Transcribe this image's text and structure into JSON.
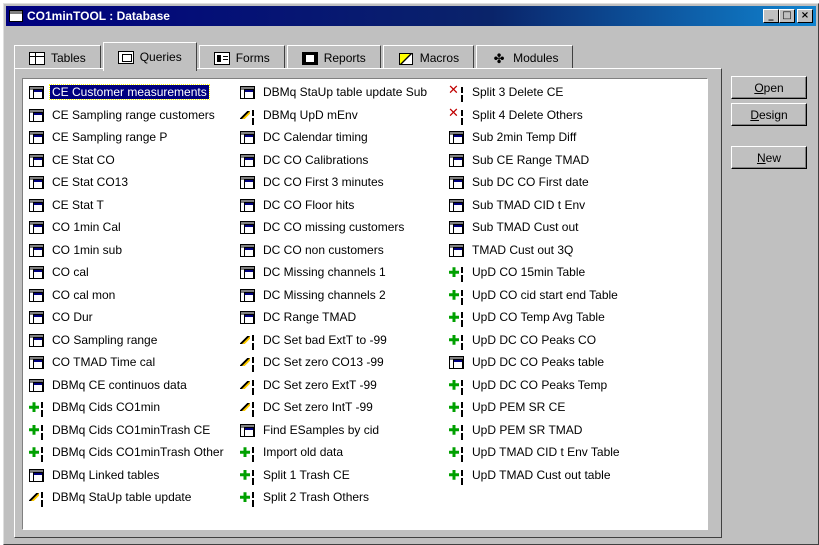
{
  "window": {
    "title": "CO1minTOOL : Database",
    "icon": "database-window-icon",
    "controls": [
      "minimize",
      "maximize",
      "close"
    ]
  },
  "tabs": [
    {
      "label": "Tables",
      "icon": "table-icon",
      "active": false
    },
    {
      "label": "Queries",
      "icon": "query-icon",
      "active": true
    },
    {
      "label": "Forms",
      "icon": "form-icon",
      "active": false
    },
    {
      "label": "Reports",
      "icon": "report-icon",
      "active": false
    },
    {
      "label": "Macros",
      "icon": "macro-icon",
      "active": false
    },
    {
      "label": "Modules",
      "icon": "module-icon",
      "active": false
    }
  ],
  "buttons": {
    "open": {
      "access": "O",
      "rest": "pen"
    },
    "design": {
      "access": "D",
      "rest": "esign"
    },
    "new": {
      "access": "N",
      "rest": "ew"
    }
  },
  "columns": [
    [
      {
        "name": "CE Customer measurements",
        "type": "select",
        "selected": true
      },
      {
        "name": "CE Sampling range customers",
        "type": "select"
      },
      {
        "name": "CE Sampling range P",
        "type": "select"
      },
      {
        "name": "CE Stat CO",
        "type": "select"
      },
      {
        "name": "CE Stat CO13",
        "type": "select"
      },
      {
        "name": "CE Stat T",
        "type": "select"
      },
      {
        "name": "CO 1min Cal",
        "type": "select"
      },
      {
        "name": "CO 1min sub",
        "type": "select"
      },
      {
        "name": "CO cal",
        "type": "select"
      },
      {
        "name": "CO cal mon",
        "type": "select"
      },
      {
        "name": "CO Dur",
        "type": "select"
      },
      {
        "name": "CO Sampling range",
        "type": "select"
      },
      {
        "name": "CO TMAD Time cal",
        "type": "select"
      },
      {
        "name": "DBMq CE continuos data",
        "type": "select"
      },
      {
        "name": "DBMq Cids CO1min",
        "type": "append"
      },
      {
        "name": "DBMq Cids CO1minTrash CE",
        "type": "append"
      },
      {
        "name": "DBMq Cids CO1minTrash Other",
        "type": "append"
      },
      {
        "name": "DBMq Linked tables",
        "type": "select"
      },
      {
        "name": "DBMq StaUp table update",
        "type": "update"
      }
    ],
    [
      {
        "name": "DBMq StaUp table update Sub",
        "type": "select"
      },
      {
        "name": "DBMq UpD mEnv",
        "type": "update"
      },
      {
        "name": "DC Calendar timing",
        "type": "select"
      },
      {
        "name": "DC CO Calibrations",
        "type": "select"
      },
      {
        "name": "DC CO First 3 minutes",
        "type": "select"
      },
      {
        "name": "DC CO Floor hits",
        "type": "select"
      },
      {
        "name": "DC CO missing customers",
        "type": "select"
      },
      {
        "name": "DC CO non customers",
        "type": "select"
      },
      {
        "name": "DC Missing channels 1",
        "type": "select"
      },
      {
        "name": "DC Missing channels 2",
        "type": "select"
      },
      {
        "name": "DC Range TMAD",
        "type": "select"
      },
      {
        "name": "DC Set bad ExtT to -99",
        "type": "update"
      },
      {
        "name": "DC Set zero CO13 -99",
        "type": "update"
      },
      {
        "name": "DC Set zero ExtT -99",
        "type": "update"
      },
      {
        "name": "DC Set zero IntT -99",
        "type": "update"
      },
      {
        "name": "Find ESamples by cid",
        "type": "select"
      },
      {
        "name": "Import old data",
        "type": "append"
      },
      {
        "name": "Split 1 Trash CE",
        "type": "append"
      },
      {
        "name": "Split 2 Trash Others",
        "type": "append"
      }
    ],
    [
      {
        "name": "Split 3 Delete CE",
        "type": "delete"
      },
      {
        "name": "Split 4 Delete Others",
        "type": "delete"
      },
      {
        "name": "Sub 2min Temp Diff",
        "type": "select"
      },
      {
        "name": "Sub CE Range TMAD",
        "type": "select"
      },
      {
        "name": "Sub DC CO First date",
        "type": "select"
      },
      {
        "name": "Sub TMAD CID t Env",
        "type": "select"
      },
      {
        "name": "Sub TMAD Cust out",
        "type": "select"
      },
      {
        "name": "TMAD Cust out 3Q",
        "type": "select"
      },
      {
        "name": "UpD CO 15min Table",
        "type": "append"
      },
      {
        "name": "UpD CO cid start end Table",
        "type": "append"
      },
      {
        "name": "UpD CO Temp Avg Table",
        "type": "append"
      },
      {
        "name": "UpD DC CO Peaks CO",
        "type": "append"
      },
      {
        "name": "UpD DC CO Peaks table",
        "type": "select"
      },
      {
        "name": "UpD DC CO Peaks Temp",
        "type": "append"
      },
      {
        "name": "UpD PEM SR CE",
        "type": "append"
      },
      {
        "name": "UpD PEM SR TMAD",
        "type": "append"
      },
      {
        "name": "UpD TMAD CID t Env Table",
        "type": "append"
      },
      {
        "name": "UpD TMAD Cust out table",
        "type": "append"
      }
    ]
  ]
}
